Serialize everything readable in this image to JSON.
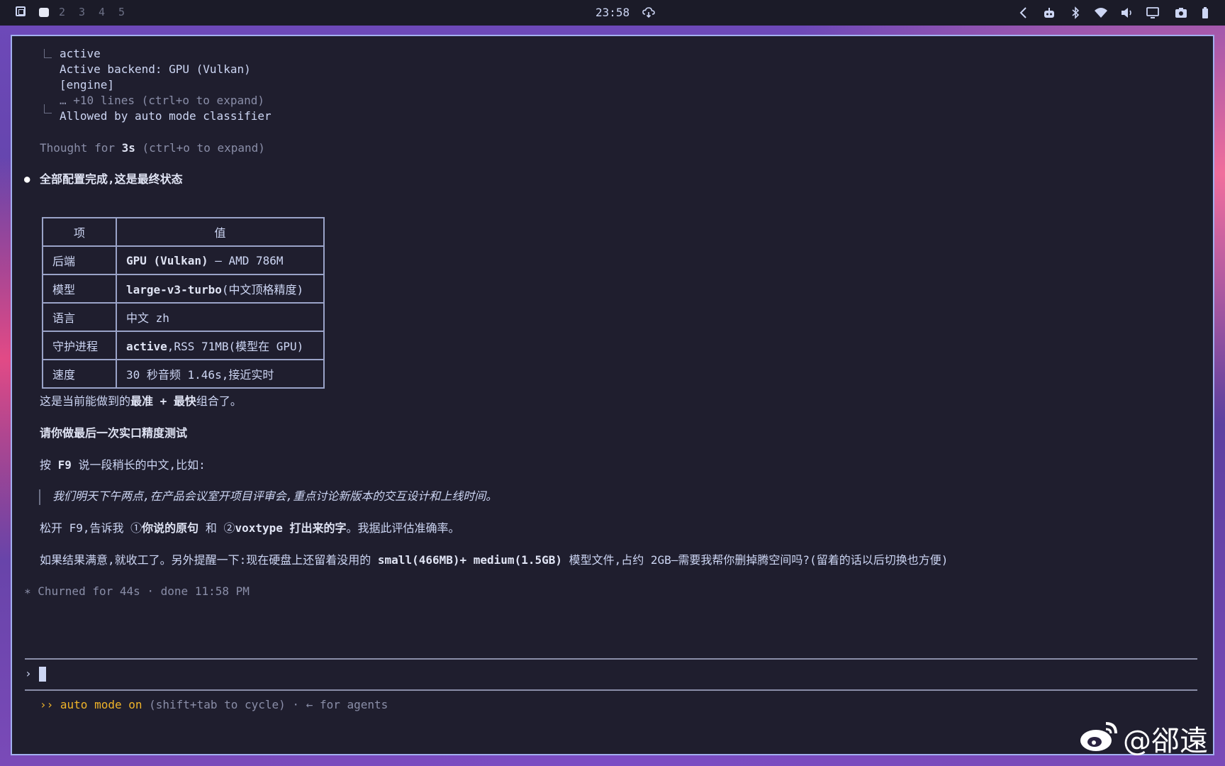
{
  "topbar": {
    "workspaces": [
      "2",
      "3",
      "4",
      "5"
    ],
    "clock": "23:58"
  },
  "history": {
    "tool_output": [
      "active",
      "Active backend: GPU (Vulkan)",
      "[engine]"
    ],
    "collapsed_hint": "… +10 lines (ctrl+o to expand)",
    "allowed": "Allowed by auto mode classifier",
    "thought_prefix": "Thought for ",
    "thought_time": "3s",
    "thought_suffix": " (ctrl+o to expand)"
  },
  "reply": {
    "heading": "全部配置完成,这是最终状态",
    "table": {
      "header": [
        "项",
        "值"
      ],
      "rows": [
        {
          "key": "后端",
          "bold": "GPU (Vulkan)",
          "rest": " — AMD 786M"
        },
        {
          "key": "模型",
          "bold": "large-v3-turbo",
          "rest": "(中文顶格精度)"
        },
        {
          "key": "语言",
          "bold": "",
          "rest": "中文 zh"
        },
        {
          "key": "守护进程",
          "bold": "active",
          "rest": ",RSS 71MB(模型在 GPU)"
        },
        {
          "key": "速度",
          "bold": "",
          "rest": "30 秒音频 1.46s,接近实时"
        }
      ]
    },
    "p1_a": "这是当前能做到的",
    "p1_b": "最准 + 最快",
    "p1_c": "组合了。",
    "p2": "请你做最后一次实口精度测试",
    "p3_a": "按 ",
    "p3_b": "F9",
    "p3_c": " 说一段稍长的中文,比如:",
    "quote": "我们明天下午两点,在产品会议室开项目评审会,重点讨论新版本的交互设计和上线时间。",
    "p4_a": "松开 F9,告诉我 ①",
    "p4_b": "你说的原句",
    "p4_c": " 和 ②",
    "p4_d": "voxtype 打出来的字",
    "p4_e": "。我据此评估准确率。",
    "p5_a": "如果结果满意,就收工了。另外提醒一下:现在硬盘上还留着没用的 ",
    "p5_b": "small(466MB)+ medium(1.5GB)",
    "p5_c": " 模型文件,占约 2GB—需要我帮你删掉腾空间吗?(留着的话以后切换也方便)",
    "churned": "∗ Churned for 44s · done 11:58 PM"
  },
  "prompt": {
    "symbol": "›",
    "status_a": "›› auto mode on",
    "status_b": " (shift+tab to cycle) · ← for agents"
  },
  "watermark": "@郤遠",
  "colors": {
    "accent": "#f0b429",
    "border": "#a3b0f0",
    "bg": "#1f1e2e"
  }
}
